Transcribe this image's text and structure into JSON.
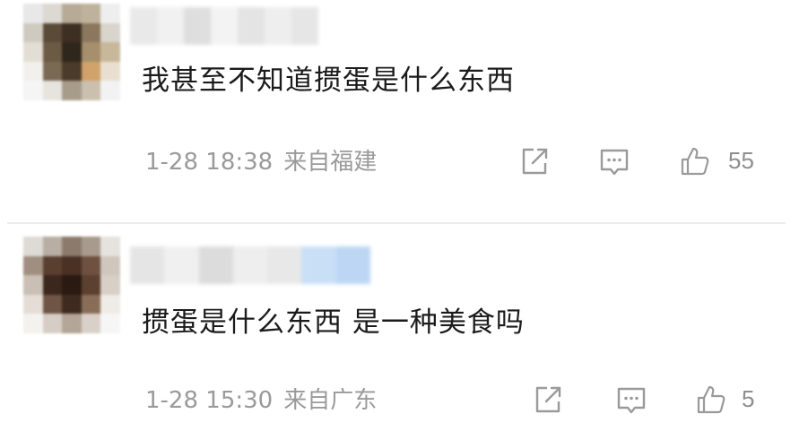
{
  "comments": [
    {
      "text": "我甚至不知道掼蛋是什么东西",
      "time": "1-28 18:38",
      "location": "来自福建",
      "likes": "55",
      "avatar_colors": [
        "#e8e8e8",
        "#dcd8d2",
        "#b7aa96",
        "#bfb29c",
        "#eeeeee",
        "#cfcac0",
        "#5a4a38",
        "#3d3023",
        "#8a775d",
        "#d9d4cc",
        "#e2ddd5",
        "#6b5a44",
        "#2f261c",
        "#a58f6c",
        "#c8b89a",
        "#f2f0ed",
        "#7a6a54",
        "#4a3b2a",
        "#d1a36a",
        "#e9dfd0",
        "#f5f5f5",
        "#e7e4df",
        "#a79b8a",
        "#cbbfae",
        "#f2f2f2"
      ],
      "username_colors": [
        "#e9e9e9",
        "#f1f1f1",
        "#dedede",
        "#f3f3f3",
        "#e4e4e4",
        "#eeeeee",
        "#e6e6e6"
      ]
    },
    {
      "text": "掼蛋是什么东西 是一种美食吗",
      "time": "1-28 15:30",
      "location": "来自广东",
      "likes": "5",
      "avatar_colors": [
        "#dedad5",
        "#b8aea3",
        "#8c7b6d",
        "#a99a8e",
        "#e6e2dd",
        "#a08f81",
        "#5a3f30",
        "#4a3124",
        "#6e5141",
        "#cfc6bd",
        "#c9bfb5",
        "#3b271c",
        "#2a1a12",
        "#5c4030",
        "#d8cfc6",
        "#e4ddd6",
        "#6f5545",
        "#3e2a1f",
        "#8a6d58",
        "#efebe6",
        "#f4f2ef",
        "#d6cec6",
        "#b3a597",
        "#d9d1c9",
        "#f6f6f6"
      ],
      "username_colors": [
        "#e5e5e5",
        "#f0f0f0",
        "#dcdcdc",
        "#eeeeee",
        "#e8e8e8",
        "#c9dff6",
        "#bcd6f3"
      ]
    }
  ],
  "icons": {
    "share": "share-icon",
    "comment": "comment-icon",
    "like": "thumbs-up-icon"
  }
}
